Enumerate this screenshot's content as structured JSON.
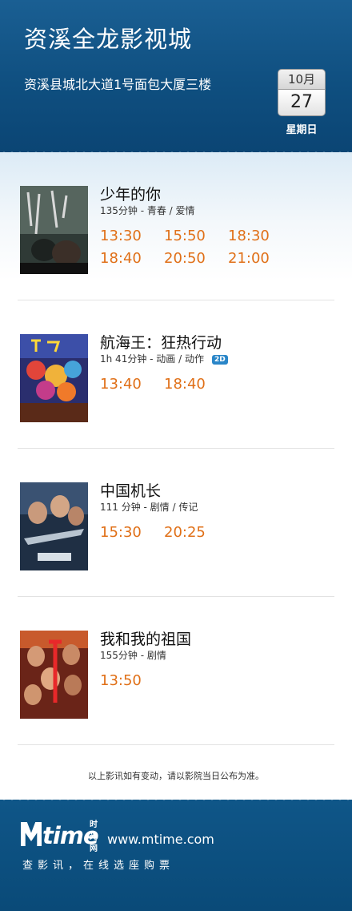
{
  "cinema": {
    "name": "资溪全龙影视城",
    "address": "资溪县城北大道1号面包大厦三楼"
  },
  "date": {
    "month": "10月",
    "day": "27",
    "weekday": "星期日"
  },
  "movies": [
    {
      "title": "少年的你",
      "meta": "135分钟 - 青春 / 爱情",
      "badge": "",
      "times": [
        "13:30",
        "15:50",
        "18:30",
        "18:40",
        "20:50",
        "21:00"
      ]
    },
    {
      "title": "航海王：狂热行动",
      "meta": "1h 41分钟 - 动画 / 动作",
      "badge": "2D",
      "times": [
        "13:40",
        "18:40"
      ]
    },
    {
      "title": "中国机长",
      "meta": "111 分钟 - 剧情 / 传记",
      "badge": "",
      "times": [
        "15:30",
        "20:25"
      ]
    },
    {
      "title": "我和我的祖国",
      "meta": "155分钟 - 剧情",
      "badge": "",
      "times": [
        "13:50"
      ]
    }
  ],
  "notice": "以上影讯如有变动，请以影院当日公布为准。",
  "footer": {
    "brand": "time",
    "brand_cn": "时光网",
    "site": "www.mtime.com",
    "slogan": "查影讯，在线选座购票"
  },
  "colors": {
    "header_blue": "#0f4f80",
    "showtime_orange": "#e07018",
    "badge_blue": "#2a86c8"
  }
}
